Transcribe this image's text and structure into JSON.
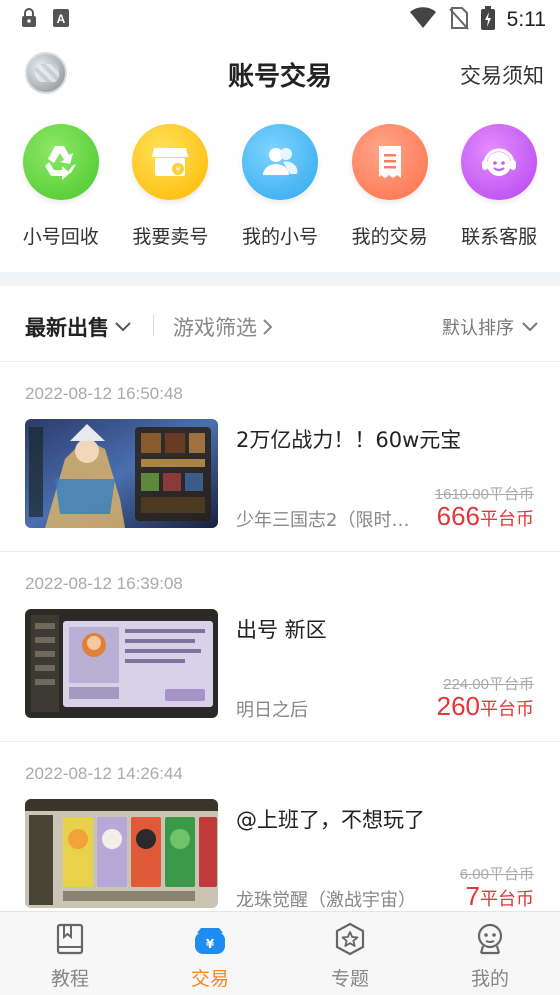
{
  "status_bar": {
    "time": "5:11",
    "icons": [
      "lock-icon",
      "a-icon",
      "wifi-icon",
      "no-sim-icon",
      "battery-charging-icon"
    ]
  },
  "header": {
    "title": "账号交易",
    "notice": "交易须知"
  },
  "actions": [
    {
      "label": "小号回收",
      "icon": "recycle-icon",
      "color": "#5fd23a"
    },
    {
      "label": "我要卖号",
      "icon": "shop-icon",
      "color": "#ffc21a"
    },
    {
      "label": "我的小号",
      "icon": "users-icon",
      "color": "#3ab3f0"
    },
    {
      "label": "我的交易",
      "icon": "receipt-icon",
      "color": "#ff7d5a"
    },
    {
      "label": "联系客服",
      "icon": "headset-icon",
      "color": "#c55bf0"
    }
  ],
  "filters": {
    "latest": "最新出售",
    "game_filter": "游戏筛选",
    "sort": "默认排序"
  },
  "listings": [
    {
      "time": "2022-08-12 16:50:48",
      "title": "2万亿战力！！60w元宝",
      "game": "少年三国志2（限时…",
      "original_price": "1610.00平台币",
      "price": "666",
      "price_unit": "平台币"
    },
    {
      "time": "2022-08-12 16:39:08",
      "title": "出号  新区",
      "game": "明日之后",
      "original_price": "224.00平台币",
      "price": "260",
      "price_unit": "平台币"
    },
    {
      "time": "2022-08-12 14:26:44",
      "title": "@上班了，不想玩了",
      "game": "龙珠觉醒（激战宇宙）",
      "original_price": "6.00平台币",
      "price": "7",
      "price_unit": "平台币"
    }
  ],
  "bottom_nav": [
    {
      "label": "教程",
      "icon": "book-icon",
      "active": false
    },
    {
      "label": "交易",
      "icon": "wallet-yen-icon",
      "active": true
    },
    {
      "label": "专题",
      "icon": "star-badge-icon",
      "active": false
    },
    {
      "label": "我的",
      "icon": "robot-face-icon",
      "active": false
    }
  ],
  "colors": {
    "accent": "#f08a21",
    "price": "#e2363a",
    "active_nav_icon": "#1f8cf0"
  }
}
